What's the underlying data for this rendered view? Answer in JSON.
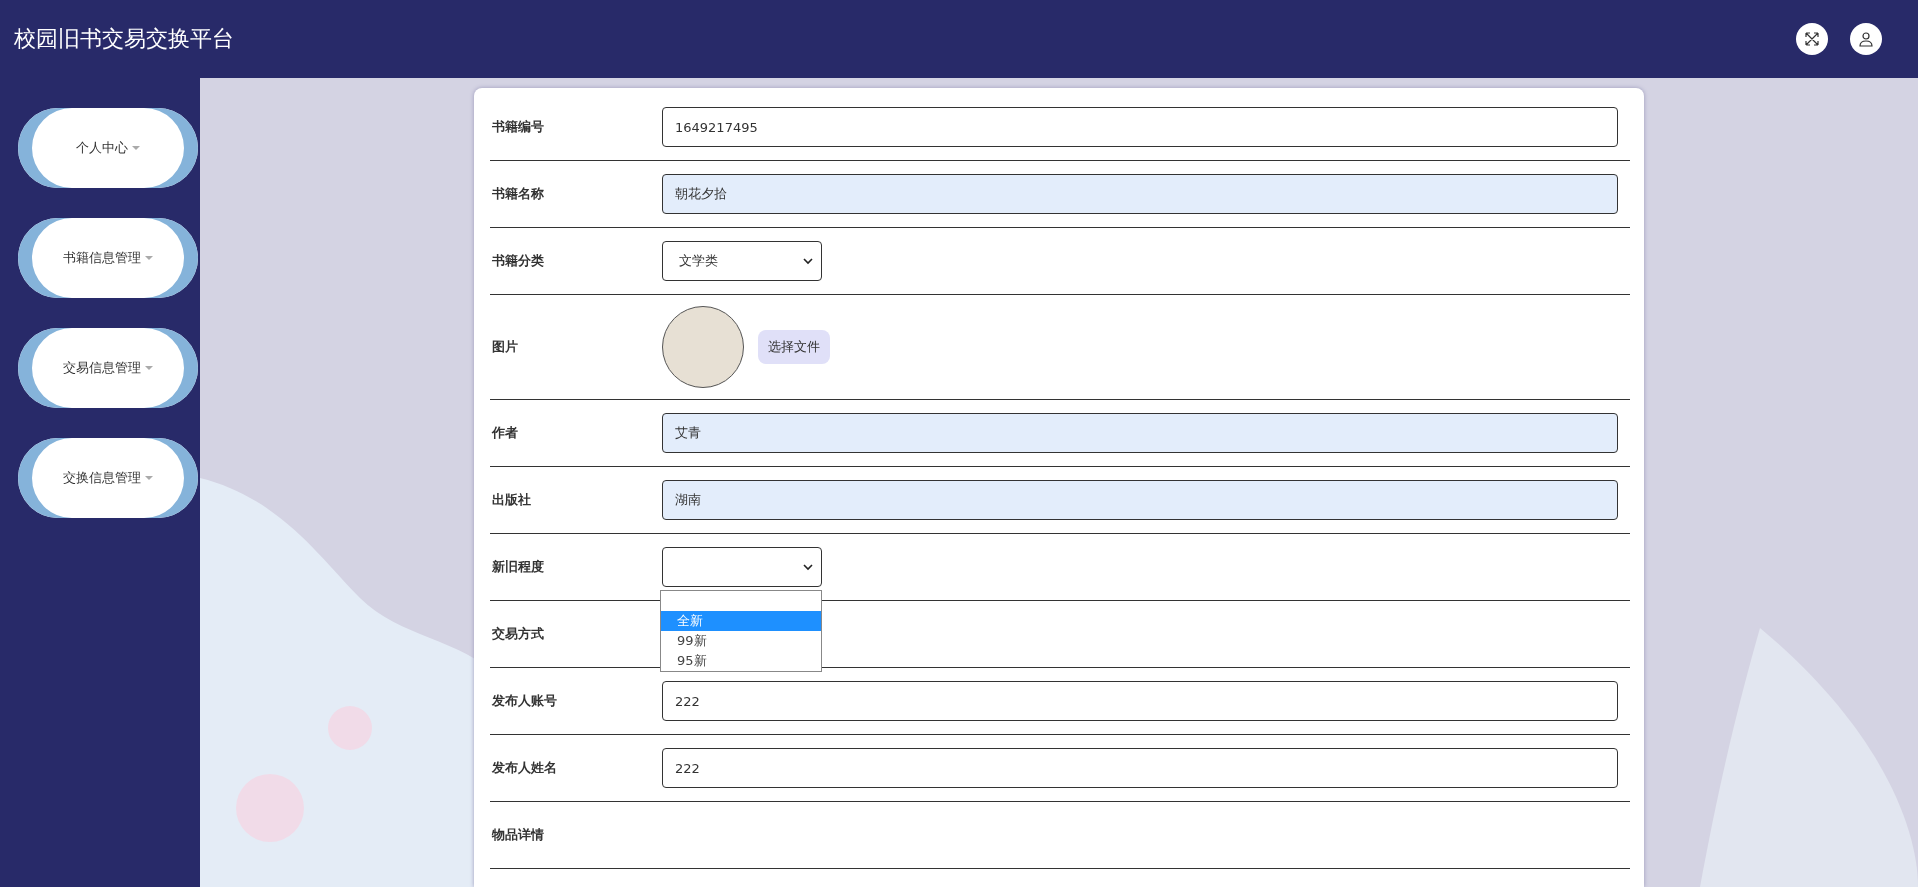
{
  "header": {
    "title": "校园旧书交易交换平台"
  },
  "sidebar": {
    "items": [
      {
        "label": "个人中心"
      },
      {
        "label": "书籍信息管理"
      },
      {
        "label": "交易信息管理"
      },
      {
        "label": "交换信息管理"
      }
    ]
  },
  "form": {
    "fields": [
      {
        "kind": "input",
        "label": "书籍编号",
        "value": "1649217495",
        "readonly": false
      },
      {
        "kind": "input",
        "label": "书籍名称",
        "value": "朝花夕拾",
        "readonly": true
      },
      {
        "kind": "select",
        "label": "书籍分类",
        "value": "文学类"
      },
      {
        "kind": "image",
        "label": "图片",
        "button": "选择文件"
      },
      {
        "kind": "input",
        "label": "作者",
        "value": "艾青",
        "readonly": true
      },
      {
        "kind": "input",
        "label": "出版社",
        "value": "湖南",
        "readonly": true
      },
      {
        "kind": "dropdown",
        "label": "新旧程度",
        "options": [
          {
            "label": "全新",
            "selected": true
          },
          {
            "label": "99新",
            "selected": false
          },
          {
            "label": "95新",
            "selected": false
          }
        ]
      },
      {
        "kind": "hidden",
        "label": "交易方式"
      },
      {
        "kind": "input",
        "label": "发布人账号",
        "value": "222",
        "readonly": false
      },
      {
        "kind": "input",
        "label": "发布人姓名",
        "value": "222",
        "readonly": false
      },
      {
        "kind": "hidden",
        "label": "物品详情"
      }
    ]
  }
}
